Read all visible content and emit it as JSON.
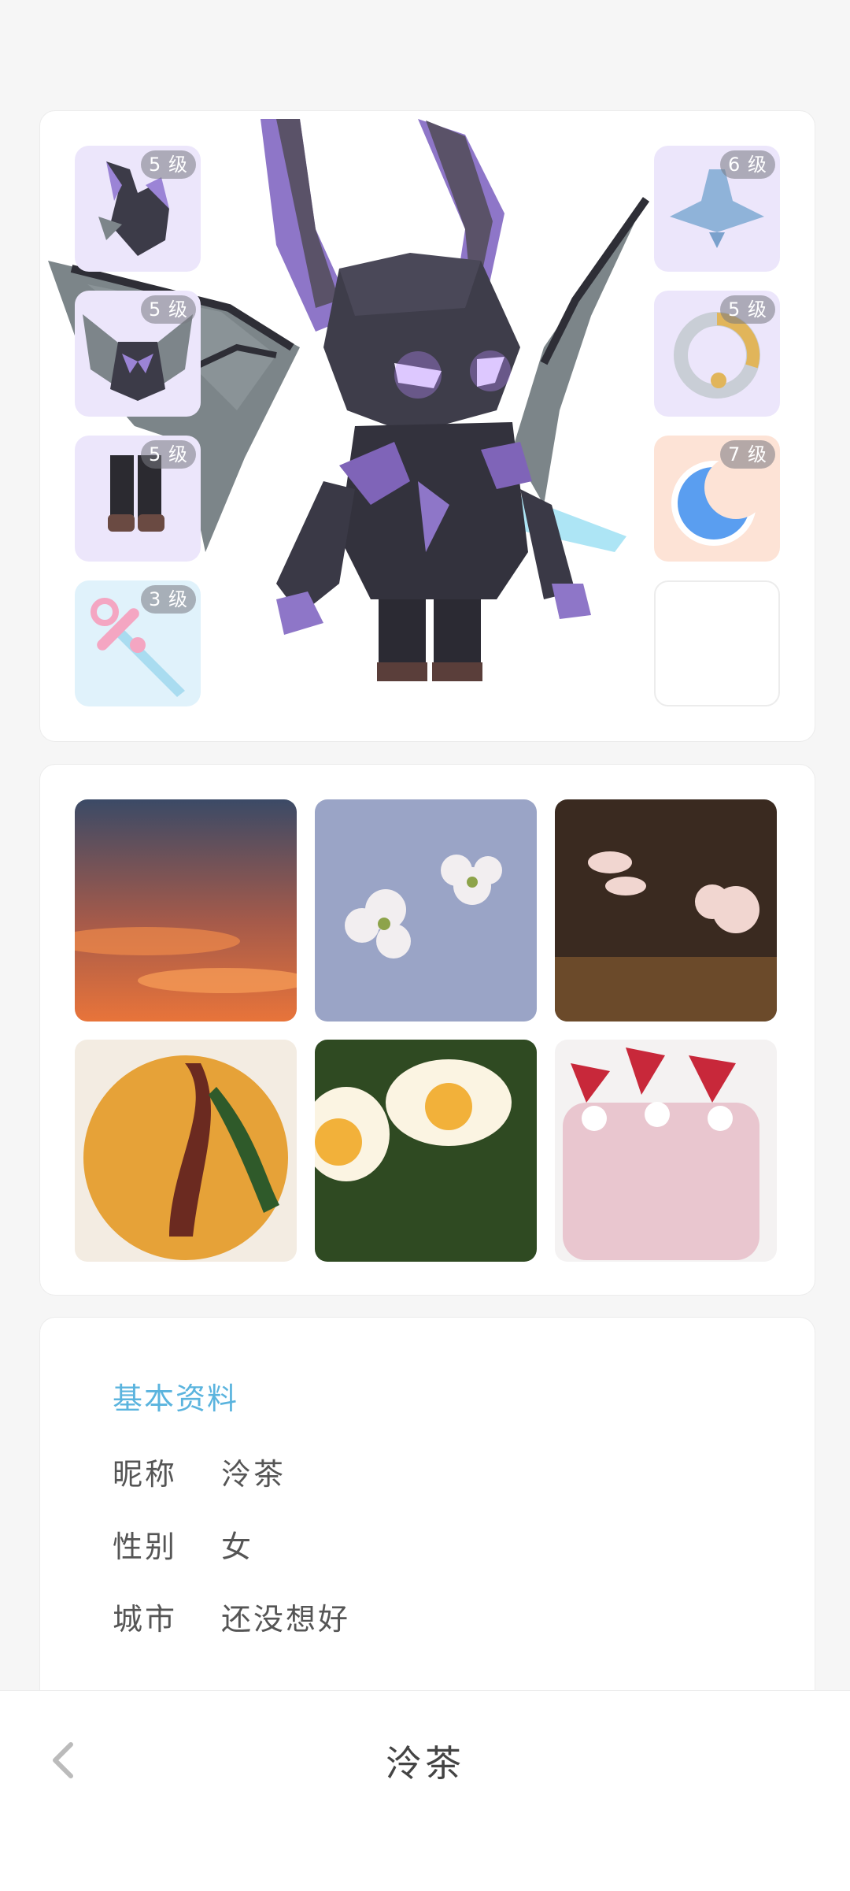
{
  "equipment": {
    "left_slots": [
      {
        "item": "dragon-helmet",
        "level": "5 级"
      },
      {
        "item": "dragon-armor",
        "level": "5 级"
      },
      {
        "item": "dark-boots",
        "level": "5 级"
      },
      {
        "item": "pink-sword",
        "level": "3 级"
      }
    ],
    "right_slots": [
      {
        "item": "blue-spinning-top",
        "level": "6 级"
      },
      {
        "item": "serpent-ring",
        "level": "5 级"
      },
      {
        "item": "blue-moon",
        "level": "7 级"
      },
      {
        "item": "empty-slot",
        "level": ""
      }
    ],
    "avatar": "purple-dragon-knight"
  },
  "photos": [
    {
      "name": "sunset-clouds",
      "colors": [
        "#3b4a66",
        "#a55a4a",
        "#e8743a"
      ]
    },
    {
      "name": "white-blossoms",
      "colors": [
        "#9aa4c6",
        "#f2eef0",
        "#6b5a4a"
      ]
    },
    {
      "name": "pink-flowers",
      "colors": [
        "#3a2a20",
        "#f1d6d0",
        "#6b4a2a"
      ]
    },
    {
      "name": "omelette-rice",
      "colors": [
        "#e6a238",
        "#6b2a20",
        "#2f5a2a"
      ]
    },
    {
      "name": "fried-eggs-greens",
      "colors": [
        "#2f4a22",
        "#fbf4e2",
        "#f2b13a"
      ]
    },
    {
      "name": "strawberry-cake",
      "colors": [
        "#e9c6cf",
        "#c8283a",
        "#ffffff"
      ]
    }
  ],
  "profile": {
    "section_title": "基本资料",
    "rows": [
      {
        "key": "昵称",
        "value": "泠茶"
      },
      {
        "key": "性别",
        "value": "女"
      },
      {
        "key": "城市",
        "value": "还没想好"
      }
    ]
  },
  "nav": {
    "title": "泠茶",
    "back_icon": "chevron-left-icon"
  },
  "colors": {
    "accent": "#5bb4de",
    "slot_purple": "#ece6fb",
    "slot_blue": "#e0f2fb",
    "slot_peach": "#fde3d6"
  }
}
